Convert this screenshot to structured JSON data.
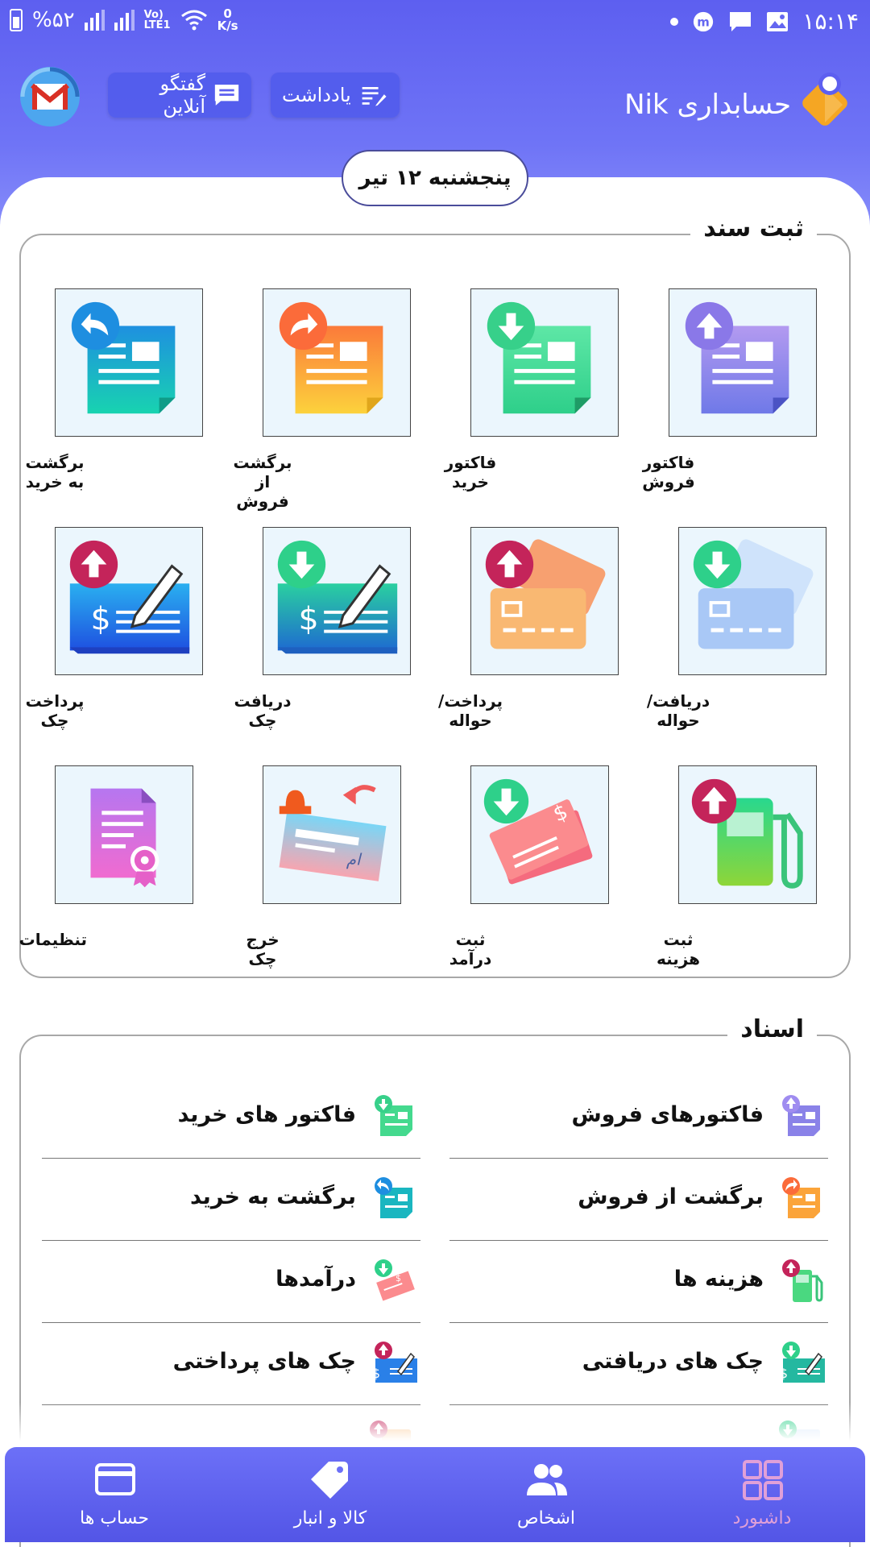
{
  "status_bar": {
    "battery": "%۵۲",
    "network": "LTE1",
    "speed_value": "0",
    "speed_unit": "K/s",
    "time": "۱۵:۱۴"
  },
  "header": {
    "app_title": "حسابداری Nik",
    "note_button": "یادداشت",
    "chat_button": "گفتگو آنلاین"
  },
  "date": "پنجشنبه ۱۲ تیر",
  "register_section": {
    "title": "ثبت سند",
    "tiles": [
      {
        "label": "فاکتور فروش",
        "icon": "sales-invoice-icon"
      },
      {
        "label": "فاکتور خرید",
        "icon": "purchase-invoice-icon"
      },
      {
        "label": "برگشت از فروش",
        "icon": "sales-return-icon"
      },
      {
        "label": "برگشت به خرید",
        "icon": "purchase-return-icon"
      },
      {
        "label": "دریافت/حواله",
        "icon": "receive-transfer-icon"
      },
      {
        "label": "پرداخت/حواله",
        "icon": "pay-transfer-icon"
      },
      {
        "label": "دریافت چک",
        "icon": "receive-check-icon"
      },
      {
        "label": "پرداخت چک",
        "icon": "pay-check-icon"
      },
      {
        "label": "ثبت هزینه",
        "icon": "expense-icon"
      },
      {
        "label": "ثبت درآمد",
        "icon": "income-icon"
      },
      {
        "label": "خرج چک",
        "icon": "spend-check-icon"
      },
      {
        "label": "تنظیمات",
        "icon": "settings-certificate-icon"
      }
    ]
  },
  "documents_section": {
    "title": "اسناد",
    "items": [
      {
        "label": "فاکتورهای فروش"
      },
      {
        "label": "فاکتور های خرید"
      },
      {
        "label": "برگشت از فروش"
      },
      {
        "label": "برگشت به خرید"
      },
      {
        "label": "هزینه ها"
      },
      {
        "label": "درآمدها"
      },
      {
        "label": "چک های دریافتی"
      },
      {
        "label": "چک های پرداختی"
      }
    ]
  },
  "bottom_nav": {
    "items": [
      {
        "label": "داشبورد",
        "icon": "dashboard-grid-icon",
        "active": true
      },
      {
        "label": "اشخاص",
        "icon": "people-icon"
      },
      {
        "label": "کالا و انبار",
        "icon": "tag-icon"
      },
      {
        "label": "حساب ها",
        "icon": "card-icon"
      }
    ]
  },
  "colors": {
    "header_gradient_top": "#5d5ff0",
    "header_gradient_bottom": "#8a90fb",
    "tile_background": "#ebf6fd",
    "active_nav": "#e0a0d8"
  }
}
